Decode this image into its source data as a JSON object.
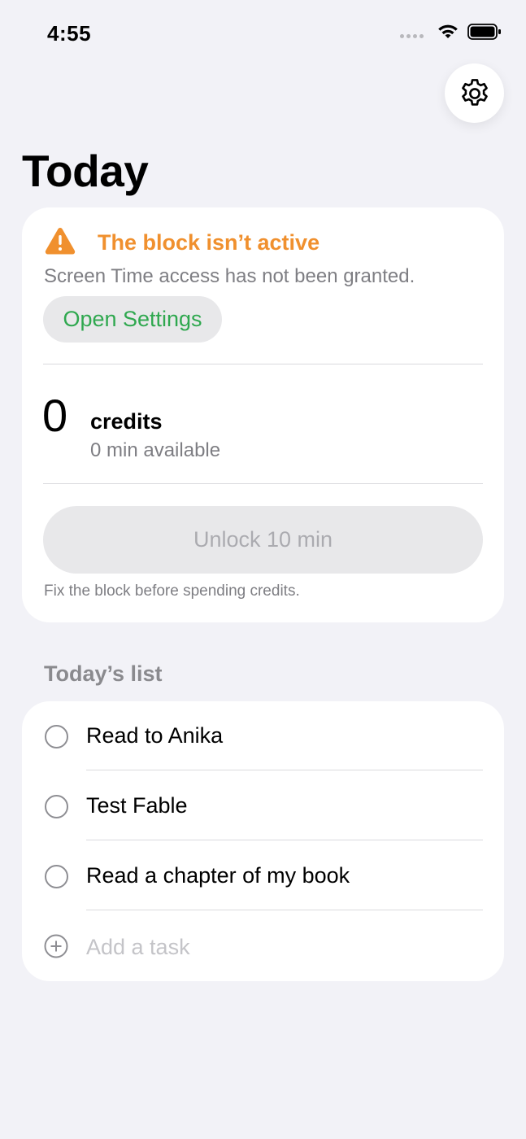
{
  "status_bar": {
    "time": "4:55",
    "icons": [
      "signal-dots-icon",
      "wifi-icon",
      "battery-icon"
    ]
  },
  "header": {
    "settings_icon": "gear-icon",
    "title": "Today"
  },
  "block_card": {
    "warning_icon": "warning-triangle-icon",
    "warning_title": "The block isn’t active",
    "warning_subtitle": "Screen Time access has not been granted.",
    "open_settings_label": "Open Settings",
    "credits_count": "0",
    "credits_label": "credits",
    "credits_available": "0 min available",
    "unlock_label": "Unlock 10 min",
    "unlock_enabled": false,
    "footnote": "Fix the block before spending credits."
  },
  "list": {
    "header": "Today’s list",
    "tasks": [
      {
        "title": "Read to Anika",
        "done": false
      },
      {
        "title": "Test Fable",
        "done": false
      },
      {
        "title": "Read a chapter of my book",
        "done": false
      }
    ],
    "add_placeholder": "Add a task",
    "add_icon": "plus-circle-icon"
  },
  "colors": {
    "background": "#F2F2F7",
    "warning": "#F0902E",
    "accent_green": "#2FA84F",
    "secondary_text": "#7E7E83"
  }
}
